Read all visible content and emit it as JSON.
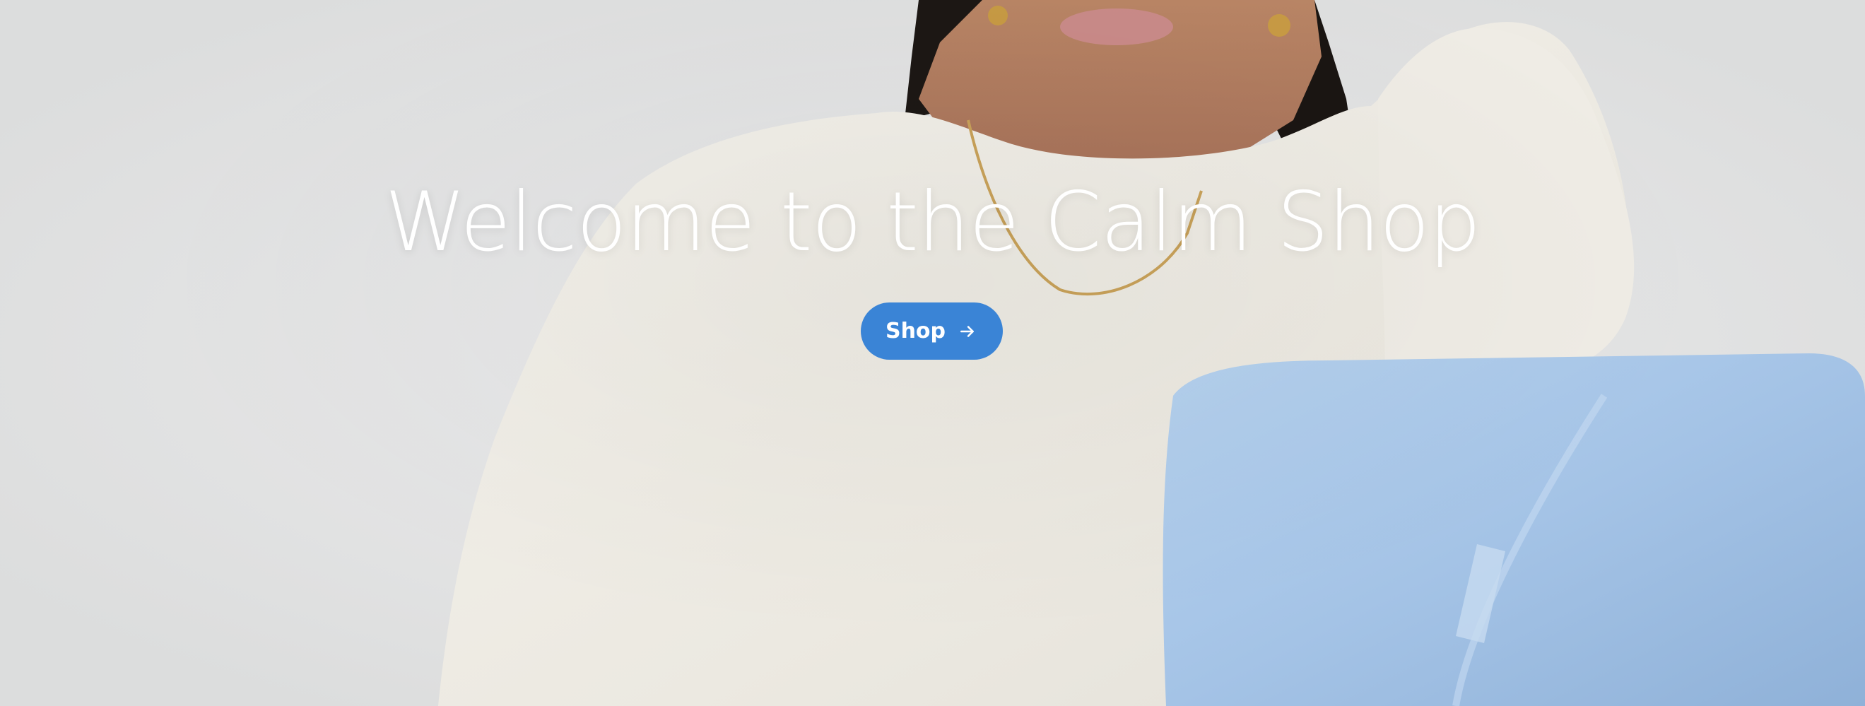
{
  "hero": {
    "title": "Welcome to the Calm Shop",
    "shop_button_label": "Shop",
    "shop_button_icon": "arrow-right-icon",
    "photo_icon": "model-with-blue-pillow-photo"
  },
  "colors": {
    "accent": "#3a84d6",
    "title_text": "#ffffff",
    "background": "#e6e7e8",
    "sweater": "#efede6",
    "pillow": "#a7c6e8"
  }
}
